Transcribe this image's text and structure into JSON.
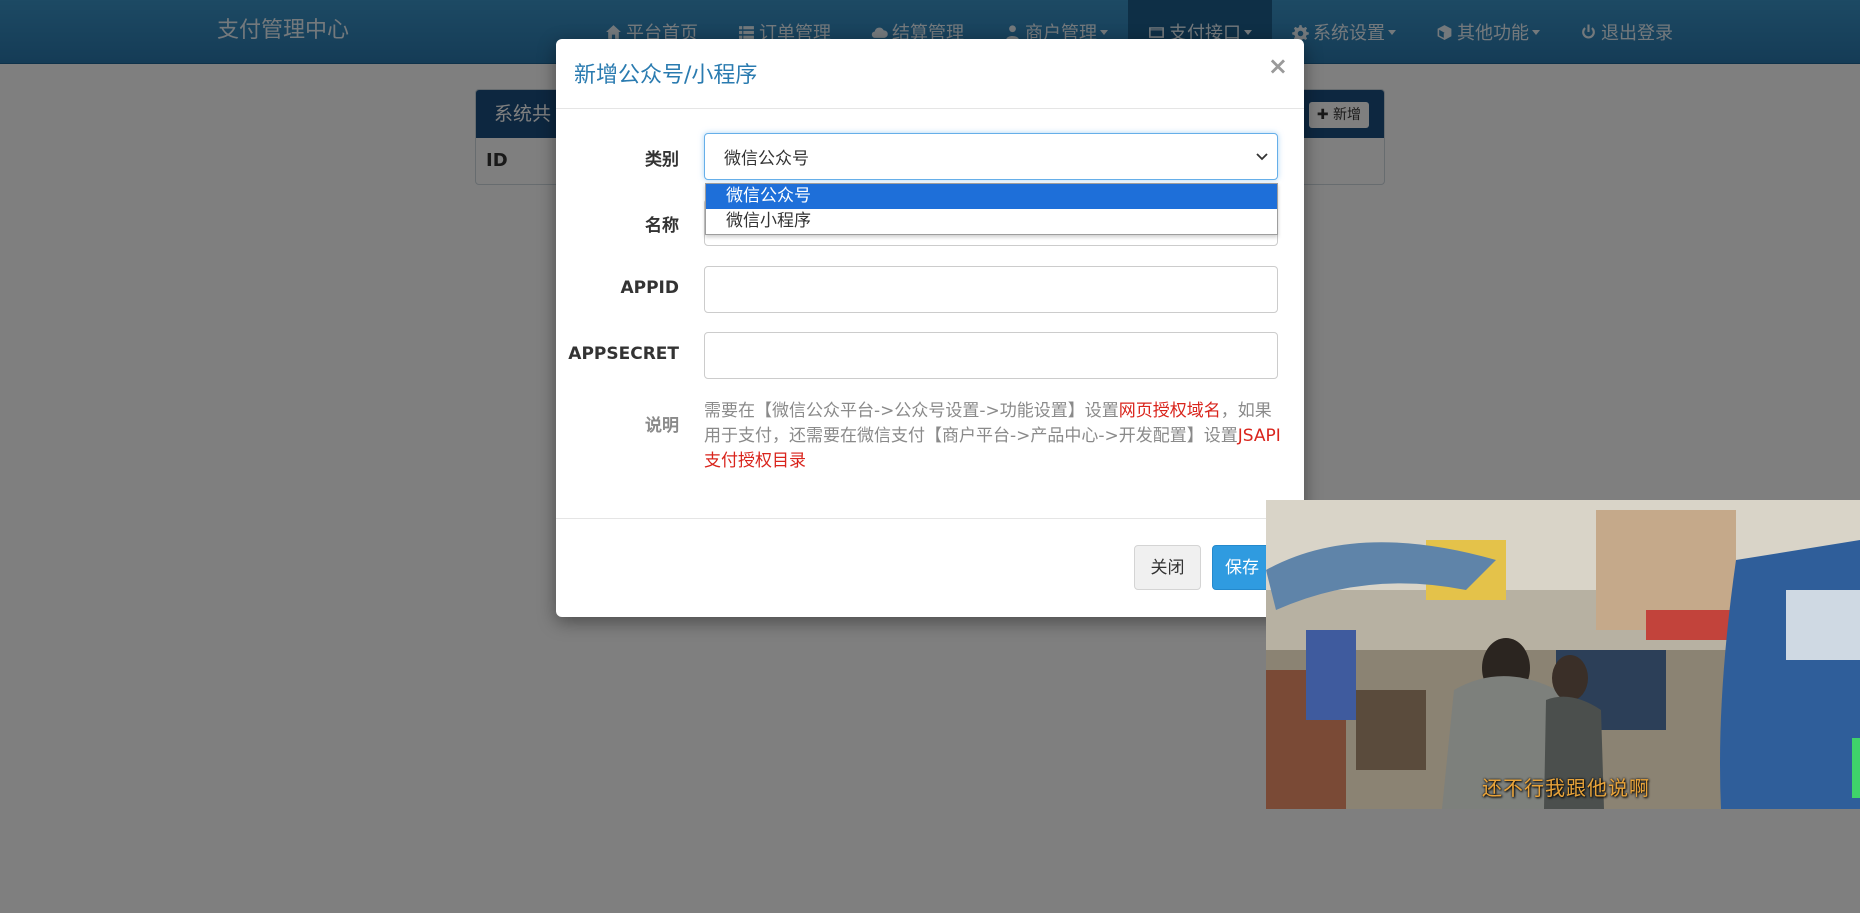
{
  "navbar": {
    "brand": "支付管理中心",
    "items": [
      {
        "label": "平台首页",
        "icon": "home-icon",
        "dropdown": false,
        "active": false
      },
      {
        "label": "订单管理",
        "icon": "list-icon",
        "dropdown": false,
        "active": false
      },
      {
        "label": "结算管理",
        "icon": "cloud-icon",
        "dropdown": false,
        "active": false
      },
      {
        "label": "商户管理",
        "icon": "user-icon",
        "dropdown": true,
        "active": false
      },
      {
        "label": "支付接口",
        "icon": "card-icon",
        "dropdown": true,
        "active": true
      },
      {
        "label": "系统设置",
        "icon": "gear-icon",
        "dropdown": true,
        "active": false
      },
      {
        "label": "其他功能",
        "icon": "cube-icon",
        "dropdown": true,
        "active": false
      },
      {
        "label": "退出登录",
        "icon": "power-icon",
        "dropdown": false,
        "active": false
      }
    ]
  },
  "background_panel": {
    "title": "系统共",
    "add_button": "新增",
    "table_header_id": "ID"
  },
  "modal": {
    "title": "新增公众号/小程序",
    "close_symbol": "×",
    "fields": {
      "category": {
        "label": "类别",
        "value": "微信公众号"
      },
      "name": {
        "label": "名称",
        "value": ""
      },
      "appid": {
        "label": "APPID",
        "value": ""
      },
      "appsecret": {
        "label": "APPSECRET",
        "value": ""
      }
    },
    "dropdown_options": [
      "微信公众号",
      "微信小程序"
    ],
    "note": {
      "label": "说明",
      "part1": "需要在【微信公众平台->公众号设置->功能设置】设置",
      "link1": "网页授权域名",
      "part2": "，如果用于支付，还需要在微信支付【商户平台->产品中心->开发配置】设置",
      "link2": "JSAPI支付授权目录"
    },
    "buttons": {
      "close": "关闭",
      "save": "保存"
    }
  },
  "video": {
    "subtitle": "还不行我跟他说啊"
  },
  "colors": {
    "navbar": "#2a84bd",
    "nav_active": "#1d5f8c",
    "modal_title": "#2a7bb0",
    "highlight_red": "#d9241c",
    "save_button": "#2f9be0",
    "dropdown_selected": "#1e6fd9"
  }
}
